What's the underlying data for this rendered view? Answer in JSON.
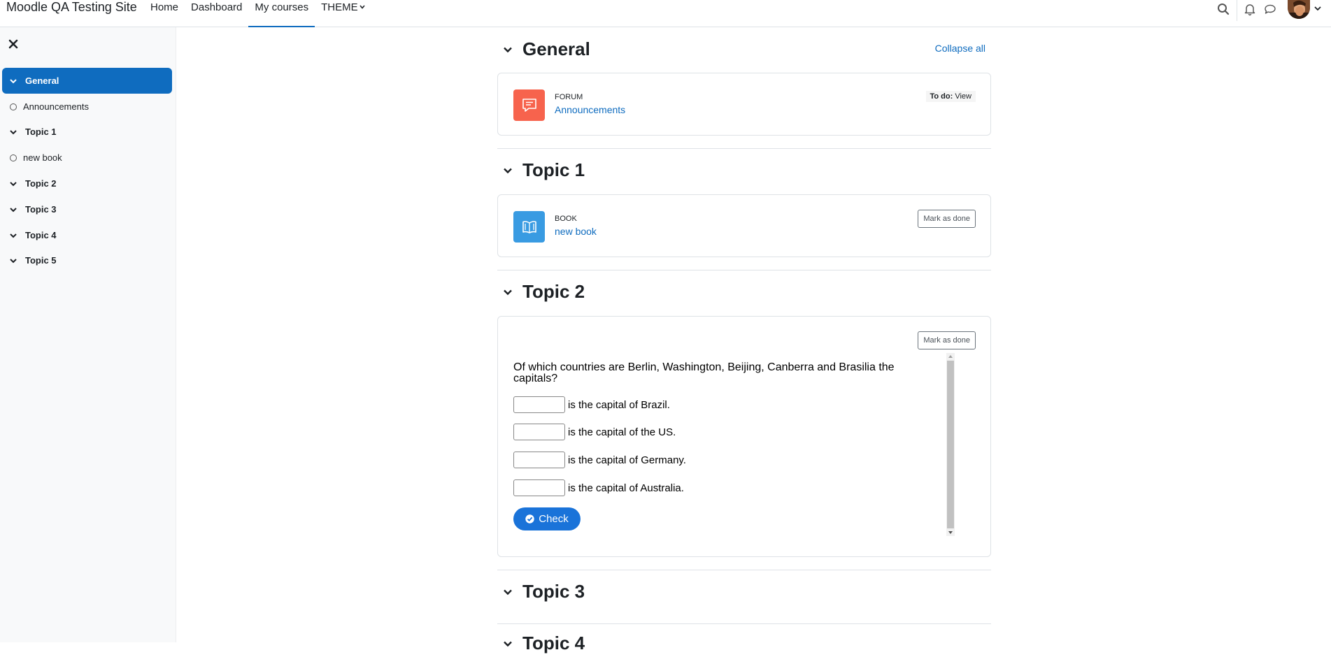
{
  "navbar": {
    "site_name": "Moodle QA Testing Site",
    "links": [
      "Home",
      "Dashboard",
      "My courses",
      "THEME"
    ],
    "active_link": "My courses"
  },
  "drawer": {
    "items": [
      {
        "label": "General",
        "kind": "section",
        "active": true
      },
      {
        "label": "Announcements",
        "kind": "activity"
      },
      {
        "label": "Topic 1",
        "kind": "section"
      },
      {
        "label": "new book",
        "kind": "activity"
      },
      {
        "label": "Topic 2",
        "kind": "section"
      },
      {
        "label": "Topic 3",
        "kind": "section"
      },
      {
        "label": "Topic 4",
        "kind": "section"
      },
      {
        "label": "Topic 5",
        "kind": "section"
      }
    ]
  },
  "course": {
    "collapse_all": "Collapse all",
    "sections": [
      {
        "title": "General"
      },
      {
        "title": "Topic 1"
      },
      {
        "title": "Topic 2"
      },
      {
        "title": "Topic 3"
      },
      {
        "title": "Topic 4"
      }
    ],
    "forum": {
      "type": "FORUM",
      "name": "Announcements",
      "todo_label": "To do:",
      "todo_value": "View",
      "color": "#f7634d"
    },
    "book": {
      "type": "BOOK",
      "name": "new book",
      "mark_done": "Mark as done",
      "color": "#399be2"
    },
    "h5p": {
      "mark_done": "Mark as done",
      "question": "Of which countries are Berlin, Washington, Beijing, Canberra and Brasilia the capitals?",
      "blanks": [
        {
          "value": "",
          "suffix": "is the capital of Brazil."
        },
        {
          "value": "",
          "suffix": "is the capital of the US."
        },
        {
          "value": "",
          "suffix": "is the capital of Germany."
        },
        {
          "value": "",
          "suffix": "is the capital of Australia."
        }
      ],
      "check_label": "Check"
    }
  },
  "colors": {
    "brand": "#0f6cbf",
    "check_button": "#1a73d9"
  }
}
